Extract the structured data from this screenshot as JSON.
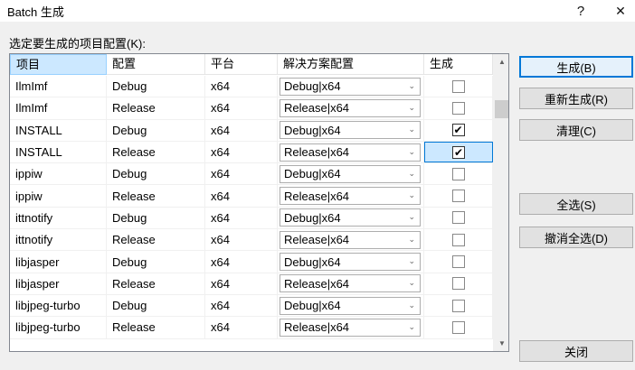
{
  "window": {
    "title": "Batch 生成",
    "help_glyph": "?",
    "close_glyph": "✕"
  },
  "prompt": "选定要生成的项目配置(K):",
  "columns": [
    "项目",
    "配置",
    "平台",
    "解决方案配置",
    "生成"
  ],
  "rows": [
    {
      "project": "IlmImf",
      "config": "Debug",
      "platform": "x64",
      "solution": "Debug|x64",
      "build": false
    },
    {
      "project": "IlmImf",
      "config": "Release",
      "platform": "x64",
      "solution": "Release|x64",
      "build": false
    },
    {
      "project": "INSTALL",
      "config": "Debug",
      "platform": "x64",
      "solution": "Debug|x64",
      "build": true
    },
    {
      "project": "INSTALL",
      "config": "Release",
      "platform": "x64",
      "solution": "Release|x64",
      "build": true
    },
    {
      "project": "ippiw",
      "config": "Debug",
      "platform": "x64",
      "solution": "Debug|x64",
      "build": false
    },
    {
      "project": "ippiw",
      "config": "Release",
      "platform": "x64",
      "solution": "Release|x64",
      "build": false
    },
    {
      "project": "ittnotify",
      "config": "Debug",
      "platform": "x64",
      "solution": "Debug|x64",
      "build": false
    },
    {
      "project": "ittnotify",
      "config": "Release",
      "platform": "x64",
      "solution": "Release|x64",
      "build": false
    },
    {
      "project": "libjasper",
      "config": "Debug",
      "platform": "x64",
      "solution": "Debug|x64",
      "build": false
    },
    {
      "project": "libjasper",
      "config": "Release",
      "platform": "x64",
      "solution": "Release|x64",
      "build": false
    },
    {
      "project": "libjpeg-turbo",
      "config": "Debug",
      "platform": "x64",
      "solution": "Debug|x64",
      "build": false
    },
    {
      "project": "libjpeg-turbo",
      "config": "Release",
      "platform": "x64",
      "solution": "Release|x64",
      "build": false
    }
  ],
  "buttons": {
    "build": "生成(B)",
    "rebuild": "重新生成(R)",
    "clean": "清理(C)",
    "select_all": "全选(S)",
    "deselect_all": "撤消全选(D)",
    "close": "关闭"
  },
  "icons": {
    "dropdown": "chevron-down-icon",
    "check": "✔"
  }
}
